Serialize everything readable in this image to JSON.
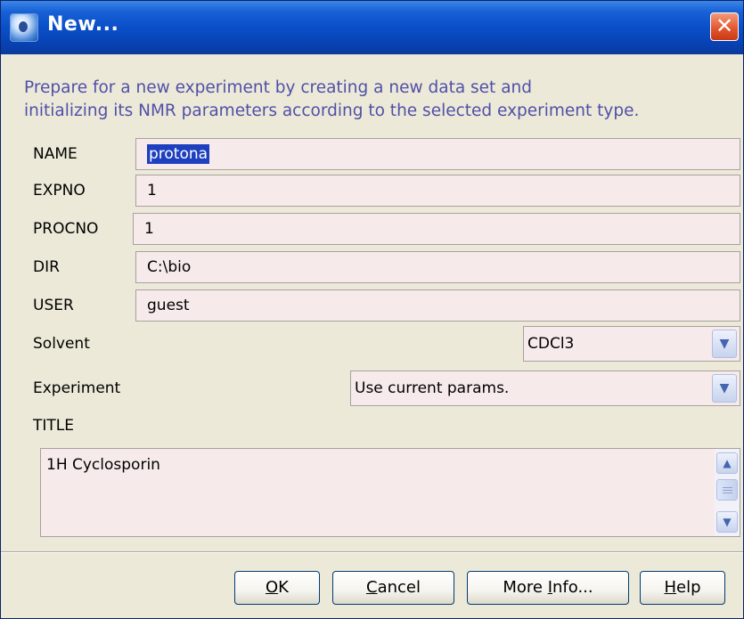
{
  "window": {
    "title": "New...",
    "close_glyph": "✕",
    "app_icon": "nmr-app-icon"
  },
  "description": {
    "line1": "Prepare for a new experiment by creating a new data set and",
    "line2": "initializing its NMR parameters according to the selected experiment type."
  },
  "fields": {
    "name": {
      "label": "NAME",
      "value": "protona"
    },
    "expno": {
      "label": "EXPNO",
      "value": "1"
    },
    "procno": {
      "label": "PROCNO",
      "value": "1"
    },
    "dir": {
      "label": "DIR",
      "value": "C:\\bio"
    },
    "user": {
      "label": "USER",
      "value": "guest"
    }
  },
  "solvent": {
    "label": "Solvent",
    "value": "CDCl3"
  },
  "experiment": {
    "label": "Experiment",
    "value": "Use current params."
  },
  "title_field": {
    "label": "TITLE",
    "value": "1H Cyclosporin"
  },
  "buttons": {
    "ok": {
      "mnemonic": "O",
      "rest": "K"
    },
    "cancel": {
      "mnemonic": "C",
      "rest": "ancel"
    },
    "more_info": {
      "before": "More ",
      "mnemonic": "I",
      "rest": "nfo..."
    },
    "help": {
      "mnemonic": "H",
      "rest": "elp"
    }
  },
  "colors": {
    "titlebar": "#0a4fc8",
    "description_text": "#5050a8",
    "input_bg": "#f7eaea",
    "selection": "#1e3fbf",
    "close_button": "#e0532c"
  }
}
